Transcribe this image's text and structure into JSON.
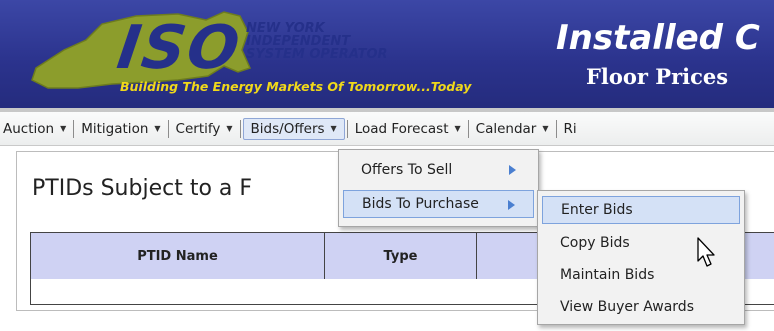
{
  "header": {
    "logo_text": "ISO",
    "org_line1": "NEW YORK",
    "org_line2": "INDEPENDENT",
    "org_line3": "SYSTEM OPERATOR",
    "tagline": "Building The Energy Markets Of Tomorrow...Today",
    "app_title": "Installed C",
    "app_subtitle": "Floor Prices",
    "colors": {
      "banner": "#2b338d",
      "tagline": "#f0d81a",
      "logo": "#8a9a2a"
    }
  },
  "menu": {
    "items": [
      {
        "label": "Auction",
        "caret": "▼"
      },
      {
        "label": "Mitigation",
        "caret": "▼"
      },
      {
        "label": "Certify",
        "caret": "▼"
      },
      {
        "label": "Bids/Offers",
        "caret": "▼",
        "active": true
      },
      {
        "label": "Load Forecast",
        "caret": "▼"
      },
      {
        "label": "Calendar",
        "caret": "▼"
      },
      {
        "label": "Ri"
      }
    ]
  },
  "dropdown_bids_offers": {
    "items": [
      {
        "label": "Offers To Sell",
        "icon": "submenu-arrow-icon"
      },
      {
        "label": "Bids To Purchase",
        "icon": "submenu-arrow-icon",
        "highlighted": true
      }
    ]
  },
  "dropdown_bids_to_purchase": {
    "items": [
      {
        "label": "Enter Bids",
        "highlighted": true
      },
      {
        "label": "Copy Bids"
      },
      {
        "label": "Maintain Bids"
      },
      {
        "label": "View Buyer Awards"
      }
    ]
  },
  "main": {
    "page_title": "PTIDs Subject to a F",
    "table": {
      "columns": [
        "PTID Name",
        "Type"
      ],
      "rows": []
    }
  }
}
